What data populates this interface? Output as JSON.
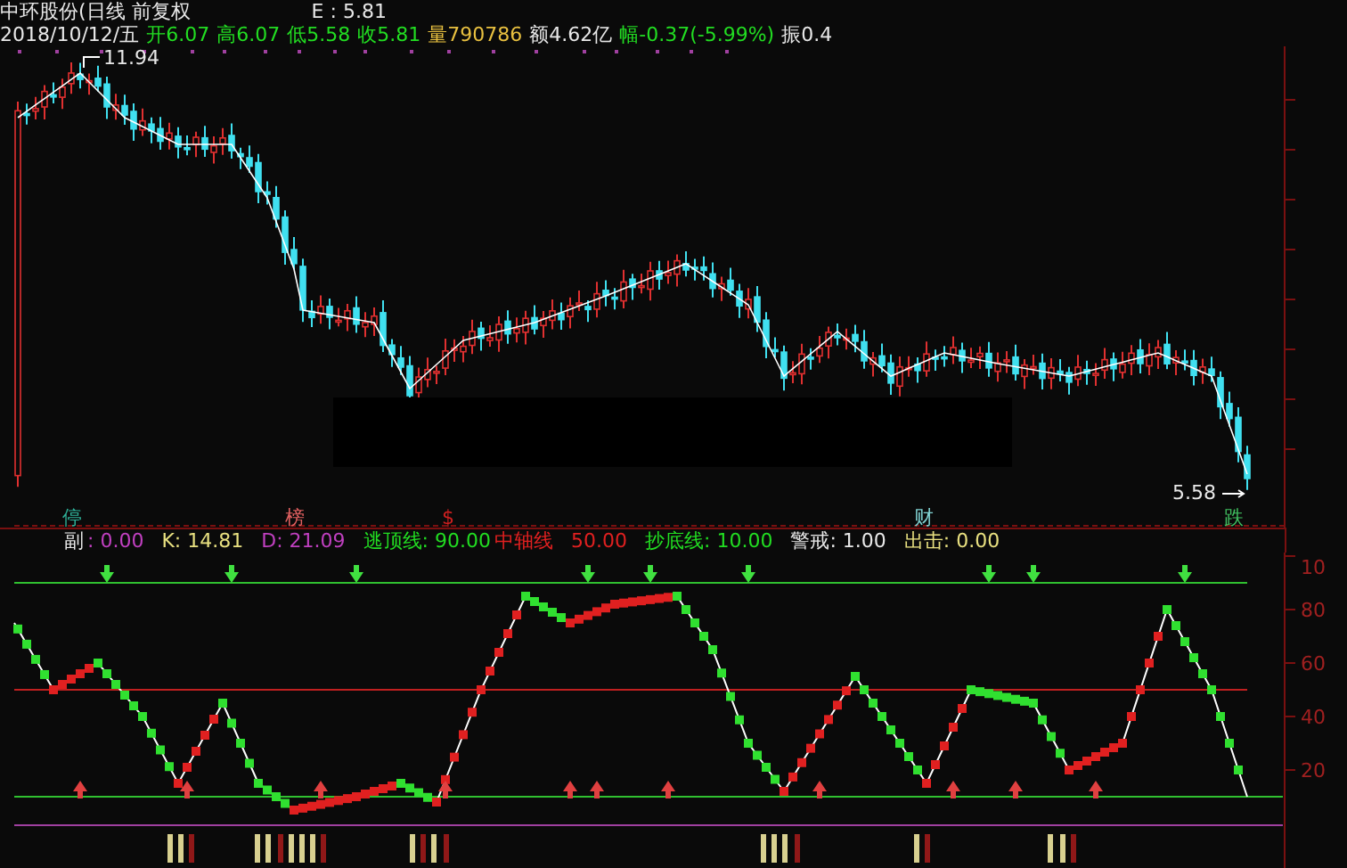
{
  "header": {
    "title": "中环股份(日线 前复权",
    "indicator_value": "E : 5.81",
    "quote": [
      {
        "text": "2018/10/12/五",
        "color": "#e8e8e8"
      },
      {
        "text": "开6.07",
        "color": "#22dd22"
      },
      {
        "text": "高6.07",
        "color": "#22dd22"
      },
      {
        "text": "低5.58",
        "color": "#22dd22"
      },
      {
        "text": "收5.81",
        "color": "#22dd22"
      },
      {
        "text": "量790786",
        "color": "#e8c040"
      },
      {
        "text": "额4.62亿",
        "color": "#e8e8e8"
      },
      {
        "text": "幅-0.37(-5.99%)",
        "color": "#22dd22"
      },
      {
        "text": "振0.4",
        "color": "#e8e8e8"
      }
    ]
  },
  "price_chart": {
    "high_label": "11.94",
    "low_label": "5.58",
    "markers": [
      {
        "text": "停",
        "color": "#2fb39a"
      },
      {
        "text": "榜",
        "color": "#e06060"
      },
      {
        "text": "$",
        "color": "#d02020"
      },
      {
        "text": "财",
        "color": "#7fd0d0"
      },
      {
        "text": "跌",
        "color": "#40c060"
      }
    ]
  },
  "indicator": {
    "legend": [
      {
        "text": "副",
        "color": "#e8e8e8"
      },
      {
        "text": ": 0.00",
        "color": "#c040c0"
      },
      {
        "text": "K: 14.81",
        "color": "#e8e080"
      },
      {
        "text": "D: 21.09",
        "color": "#c040c0"
      },
      {
        "text": "逃顶线: 90.00",
        "color": "#22dd22"
      },
      {
        "text": "中轴线",
        "color": "#e02020"
      },
      {
        "text": "50.00",
        "color": "#e02020"
      },
      {
        "text": "抄底线: 10.00",
        "color": "#22dd22"
      },
      {
        "text": "警戒: 1.00",
        "color": "#e8e8e8"
      },
      {
        "text": "出击: 0.00",
        "color": "#e8e080"
      }
    ],
    "axis_labels": [
      "10",
      "80",
      "60",
      "40",
      "20"
    ]
  }
}
